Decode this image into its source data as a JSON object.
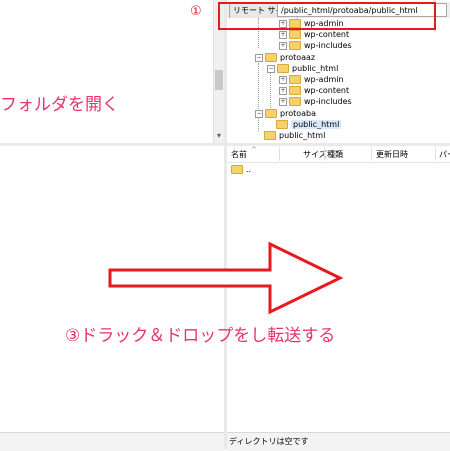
{
  "remote": {
    "label": "リモート サイト:",
    "path": "/public_html/protoaba/public_html"
  },
  "tree": {
    "nodes": [
      {
        "label": "wp-admin"
      },
      {
        "label": "wp-content"
      },
      {
        "label": "wp-includes"
      },
      {
        "label": "protoaaz"
      },
      {
        "label": "public_html"
      },
      {
        "label": "wp-admin"
      },
      {
        "label": "wp-content"
      },
      {
        "label": "wp-includes"
      },
      {
        "label": "protoaba"
      },
      {
        "label": "public_html"
      },
      {
        "label": "public_html"
      }
    ]
  },
  "list": {
    "columns": [
      "名前",
      "サイズ",
      "種類",
      "更新日時",
      "パー"
    ],
    "rows": [
      {
        "name": ".."
      }
    ]
  },
  "status": {
    "right": "ディレクトリは空です"
  },
  "annotations": {
    "step1": "①",
    "open_folder": "フォルダを開く",
    "drag_drop": "③ドラック＆ドロップをし転送する",
    "color": "#e8191e",
    "text_color": "#e8336d"
  },
  "colors": {
    "folder": "#f5d36b",
    "selection": "#d9e8fb",
    "annotation_red": "#e8191e"
  },
  "icons": [
    "folder-icon",
    "expander-plus-icon",
    "expander-minus-icon",
    "right-arrow-icon"
  ]
}
